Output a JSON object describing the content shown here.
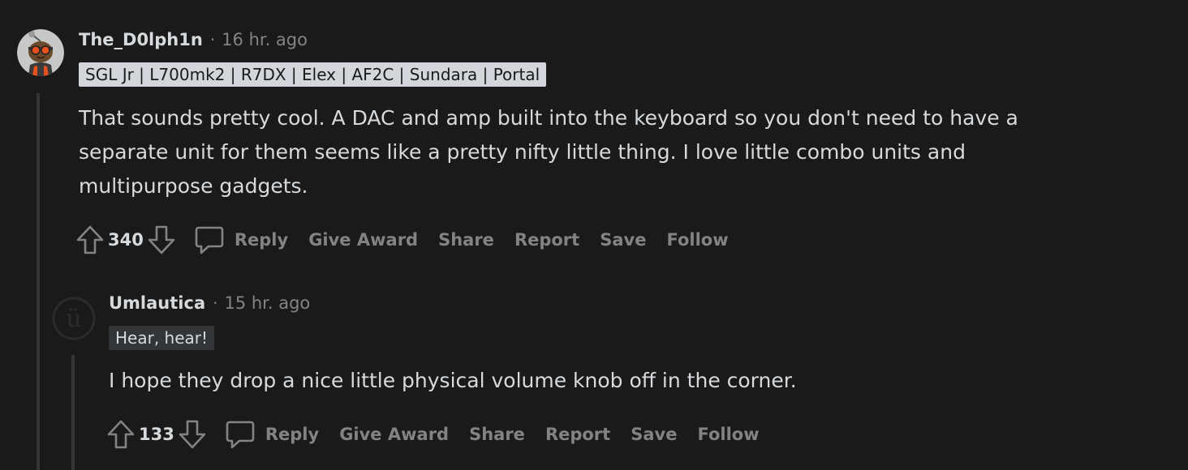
{
  "comments": [
    {
      "author": "The_D0lph1n",
      "separator": "·",
      "time": "16 hr. ago",
      "flair": "SGL Jr | L700mk2 | R7DX | Elex | AF2C | Sundara | Portal",
      "flair_bg": "#d3d6da",
      "flair_color": "#1a1a1b",
      "body": [
        "That sounds pretty cool. A DAC and amp built into the keyboard so you don't need to have a",
        "separate unit for them seems like a pretty nifty little thing. I love little combo units and",
        "multipurpose gadgets."
      ],
      "score": "340",
      "actions": {
        "reply": "Reply",
        "award": "Give Award",
        "share": "Share",
        "report": "Report",
        "save": "Save",
        "follow": "Follow"
      }
    },
    {
      "author": "Umlautica",
      "separator": "·",
      "time": "15 hr. ago",
      "flair": "Hear, hear!",
      "flair_bg": "#343536",
      "flair_color": "#d7dadc",
      "avatar_glyph": "ü",
      "body": [
        "I hope they drop a nice little physical volume knob off in the corner."
      ],
      "score": "133",
      "actions": {
        "reply": "Reply",
        "award": "Give Award",
        "share": "Share",
        "report": "Report",
        "save": "Save",
        "follow": "Follow"
      }
    }
  ],
  "colors": {
    "background": "#1a1a1b",
    "text": "#d7dadc",
    "muted": "#818384",
    "thread_line": "#343536"
  },
  "icons": [
    "upvote-icon",
    "downvote-icon",
    "comment-bubble-icon",
    "deleted-user-avatar-icon",
    "snoo-avatar"
  ]
}
